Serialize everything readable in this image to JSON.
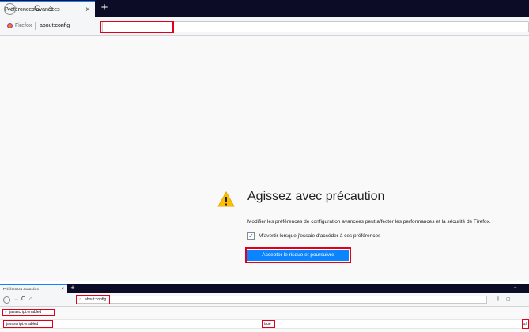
{
  "top_window": {
    "tab": {
      "title": "Préférences avancées",
      "close": "×"
    },
    "new_tab": "+",
    "nav": {
      "back": "←",
      "forward": "→",
      "reload": "C",
      "home": "⌂"
    },
    "urlbar": {
      "identity": "Firefox",
      "url": "about:config"
    },
    "warning": {
      "title": "Agissez avec précaution",
      "description": "Modifier les préférences de configuration avancées peut affecter les performances et la sécurité de Firefox.",
      "checkbox_checked": "✓",
      "checkbox_label": "M'avertir lorsque j'essaie d'accéder à ces préférences",
      "accept_button": "Accepter le risque et poursuivre"
    }
  },
  "bottom_window": {
    "tab": {
      "title": "Préférences avancées",
      "close": "×"
    },
    "new_tab": "+",
    "window_minimize": "–",
    "nav": {
      "back": "←",
      "forward": "→",
      "reload": "C",
      "home": "⌂"
    },
    "urlbar": {
      "url": "about:config",
      "search_icon": "⌕"
    },
    "toolbar": {
      "library_icon": "⫼",
      "sidebar_icon": "▢"
    },
    "search": {
      "icon": "⌕",
      "value": "javascript.enabled"
    },
    "preference": {
      "name": "javascript.enabled",
      "value": "true",
      "toggle_icon": "⇄"
    }
  },
  "colors": {
    "highlight": "#e0001b",
    "accent": "#0a84ff",
    "tabbar": "#0c0c26"
  }
}
